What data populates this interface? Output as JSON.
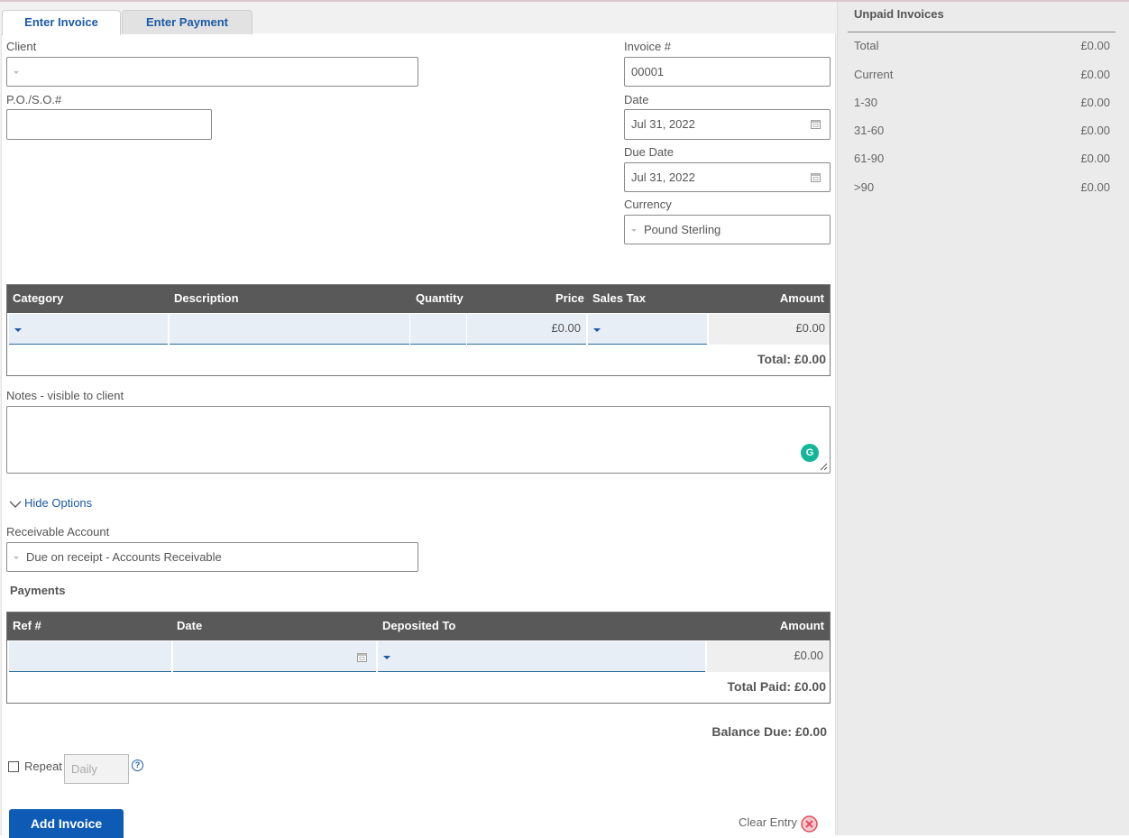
{
  "tabs": {
    "enter_invoice": "Enter Invoice",
    "enter_payment": "Enter Payment"
  },
  "form": {
    "client_label": "Client",
    "client_value": "",
    "po_label": "P.O./S.O.#",
    "po_value": "",
    "invoice_no_label": "Invoice #",
    "invoice_no_value": "00001",
    "date_label": "Date",
    "date_value": "Jul 31, 2022",
    "due_date_label": "Due Date",
    "due_date_value": "Jul 31, 2022",
    "currency_label": "Currency",
    "currency_value": "Pound Sterling"
  },
  "items_table": {
    "headers": {
      "category": "Category",
      "description": "Description",
      "quantity": "Quantity",
      "price": "Price",
      "sales_tax": "Sales Tax",
      "amount": "Amount"
    },
    "row": {
      "price": "£0.00",
      "amount": "£0.00"
    },
    "total": "Total: £0.00"
  },
  "notes": {
    "label": "Notes - visible to client",
    "g_icon_glyph": "G"
  },
  "options": {
    "hide_options": "Hide Options",
    "receivable_label": "Receivable Account",
    "receivable_value": "Due on receipt - Accounts Receivable"
  },
  "payments": {
    "title": "Payments",
    "headers": {
      "ref": "Ref #",
      "date": "Date",
      "deposited_to": "Deposited To",
      "amount": "Amount"
    },
    "row": {
      "amount": "£0.00"
    },
    "total_paid": "Total Paid: £0.00"
  },
  "balance_due": "Balance Due: £0.00",
  "repeat": {
    "label": "Repeat",
    "frequency": "Daily",
    "help_glyph": "?"
  },
  "actions": {
    "add_invoice": "Add Invoice",
    "clear_entry": "Clear Entry"
  },
  "unpaid": {
    "title": "Unpaid Invoices",
    "rows": [
      {
        "label": "Total",
        "value": "£0.00"
      },
      {
        "label": "Current",
        "value": "£0.00"
      },
      {
        "label": "1-30",
        "value": "£0.00"
      },
      {
        "label": "31-60",
        "value": "£0.00"
      },
      {
        "label": "61-90",
        "value": "£0.00"
      },
      {
        "label": ">90",
        "value": "£0.00"
      }
    ]
  },
  "icons": {
    "calendar": "calendar-icon",
    "dropdown": "chevron-down-icon",
    "grammarly": "grammarly-icon",
    "clear": "clear-circle-icon",
    "help": "help-icon"
  },
  "colors": {
    "accent": "#1c5aa6",
    "header_bg": "#595959",
    "button_bg": "#0e5bb5",
    "clear_icon": "#e05060",
    "grammarly": "#15b59a"
  }
}
